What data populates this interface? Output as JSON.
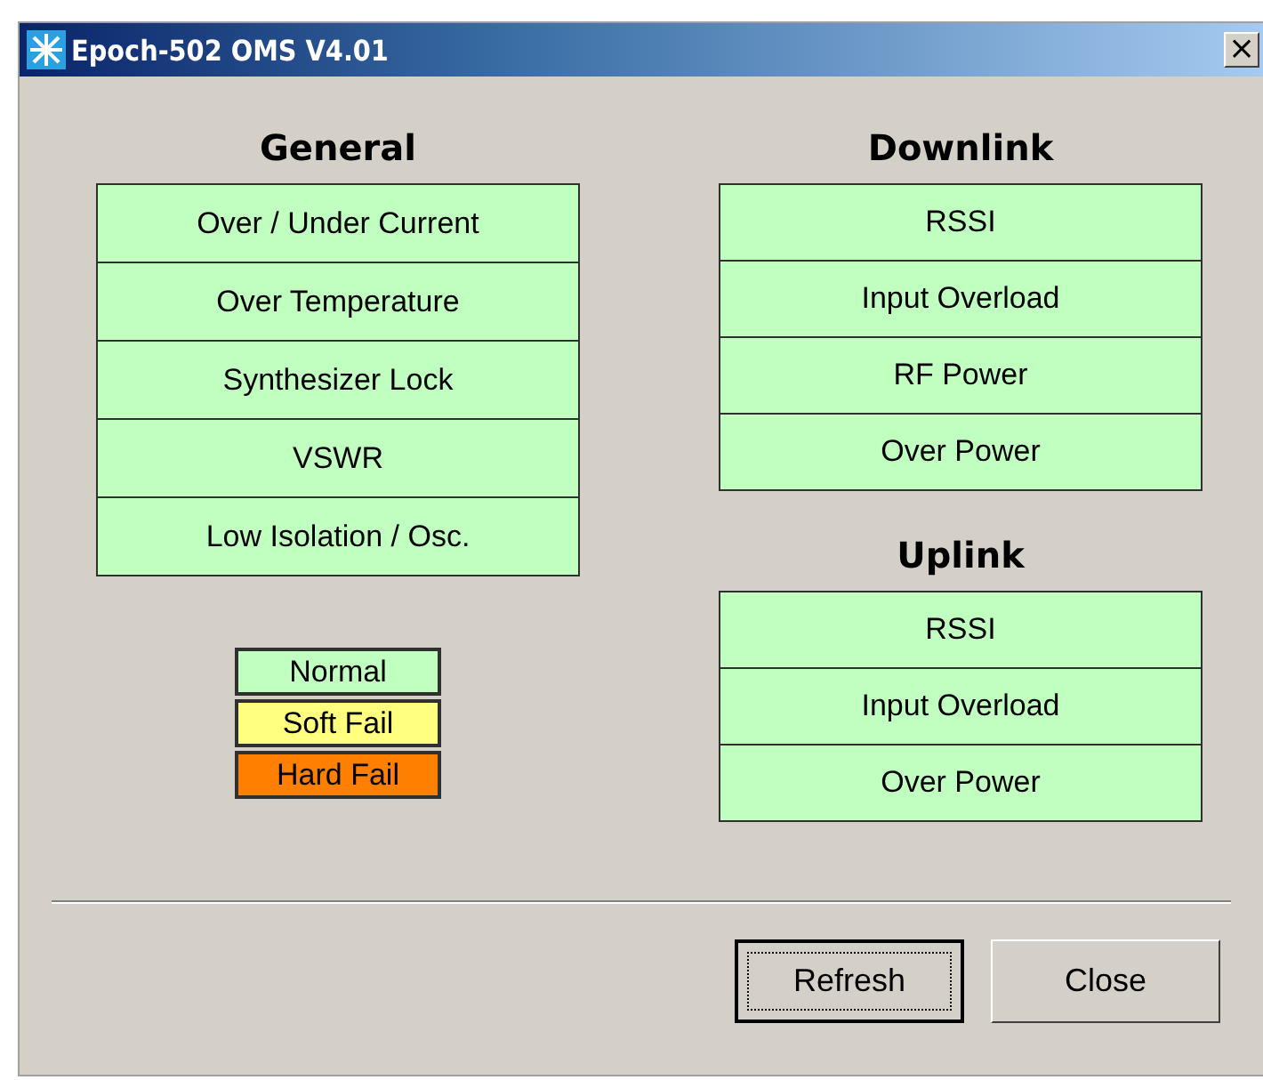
{
  "window": {
    "title": "Epoch-502 OMS V4.01",
    "close_glyph": "×"
  },
  "general": {
    "title": "General",
    "items": [
      {
        "label": "Over / Under Current",
        "color": "#c0ffc0"
      },
      {
        "label": "Over Temperature",
        "color": "#c0ffc0"
      },
      {
        "label": "Synthesizer Lock",
        "color": "#c0ffc0"
      },
      {
        "label": "VSWR",
        "color": "#c0ffc0"
      },
      {
        "label": "Low Isolation / Osc.",
        "color": "#c0ffc0"
      }
    ]
  },
  "legend": [
    {
      "label": "Normal",
      "color": "#c0ffc0"
    },
    {
      "label": "Soft Fail",
      "color": "#ffff80"
    },
    {
      "label": "Hard Fail",
      "color": "#ff8000"
    }
  ],
  "downlink": {
    "title": "Downlink",
    "items": [
      {
        "label": "RSSI",
        "color": "#c0ffc0"
      },
      {
        "label": "Input Overload",
        "color": "#c0ffc0"
      },
      {
        "label": "RF Power",
        "color": "#c0ffc0"
      },
      {
        "label": "Over Power",
        "color": "#c0ffc0"
      }
    ]
  },
  "uplink": {
    "title": "Uplink",
    "items": [
      {
        "label": "RSSI",
        "color": "#c0ffc0"
      },
      {
        "label": "Input Overload",
        "color": "#c0ffc0"
      },
      {
        "label": "Over Power",
        "color": "#c0ffc0"
      }
    ]
  },
  "buttons": [
    {
      "label": "Refresh",
      "focused": true
    },
    {
      "label": "Close",
      "focused": false
    }
  ]
}
